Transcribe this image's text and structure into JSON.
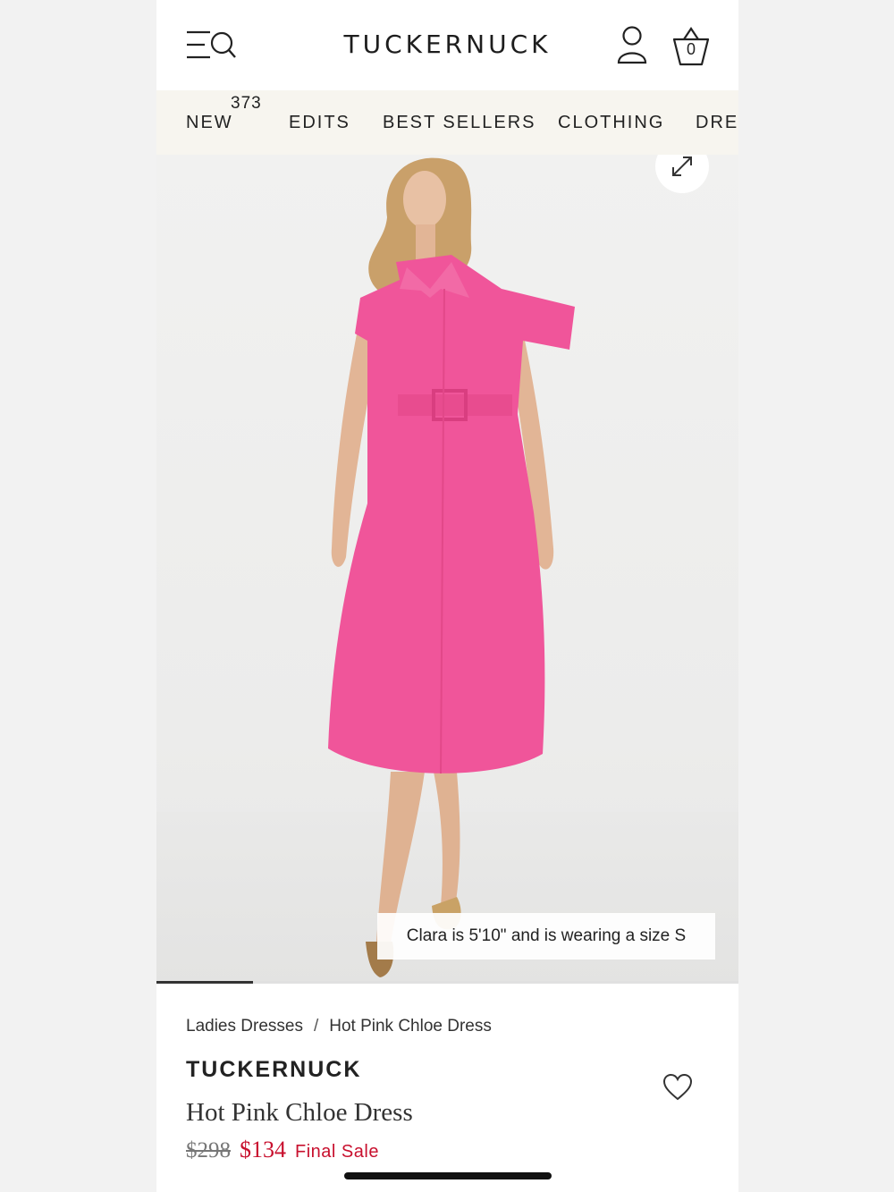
{
  "header": {
    "logo": "TUCKERNUCK",
    "bag_count": "0",
    "icons": [
      "menu-icon",
      "search-icon",
      "account-icon",
      "bag-icon"
    ]
  },
  "nav": {
    "items": [
      {
        "label": "NEW"
      },
      {
        "label": "EDITS"
      },
      {
        "label": "BEST SELLERS"
      },
      {
        "label": "CLOTHING"
      },
      {
        "label": "DRES"
      }
    ],
    "new_badge": "373"
  },
  "hero": {
    "caption": "Clara is 5'10\" and is wearing a size S",
    "image_progress_fraction": 0.166,
    "dress_color": "#f0559a",
    "icons": [
      "expand-icon"
    ]
  },
  "product": {
    "breadcrumb": [
      "Ladies Dresses",
      "Hot Pink Chloe Dress"
    ],
    "breadcrumb_separator": "/",
    "brand": "TUCKERNUCK",
    "title": "Hot Pink Chloe Dress",
    "price_original": "$298",
    "price_sale": "$134",
    "sale_label": "Final Sale",
    "sale_color": "#c8102e",
    "icons": [
      "heart-icon"
    ]
  }
}
